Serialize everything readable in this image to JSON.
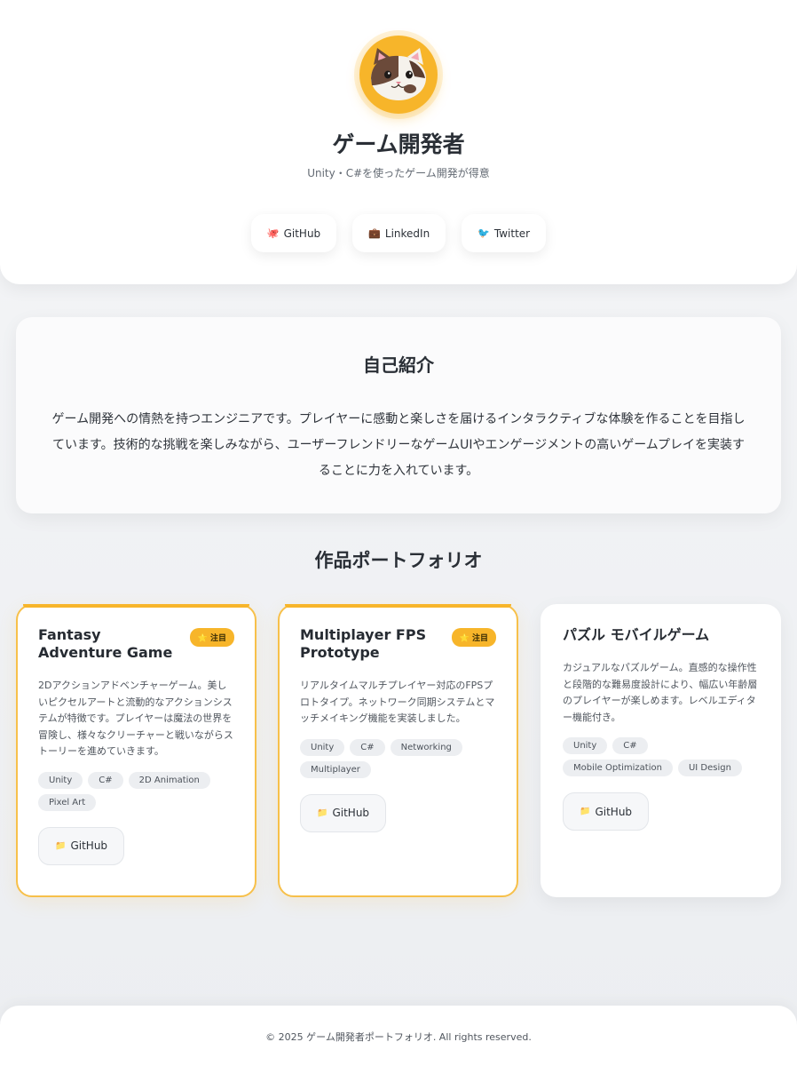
{
  "header": {
    "title": "ゲーム開発者",
    "subtitle": "Unity・C#を使ったゲーム開発が得意",
    "avatar_icon": "cat-face-icon",
    "social": [
      {
        "icon": "🐙",
        "label": "GitHub"
      },
      {
        "icon": "💼",
        "label": "LinkedIn"
      },
      {
        "icon": "🐦",
        "label": "Twitter"
      }
    ]
  },
  "about": {
    "heading": "自己紹介",
    "text": "ゲーム開発への情熱を持つエンジニアです。プレイヤーに感動と楽しさを届けるインタラクティブな体験を作ることを目指しています。技術的な挑戦を楽しみながら、ユーザーフレンドリーなゲームUIやエンゲージメントの高いゲームプレイを実装することに力を入れています。"
  },
  "portfolio": {
    "heading": "作品ポートフォリオ",
    "projects": [
      {
        "title": "Fantasy Adventure Game",
        "badge": "⭐ 注目",
        "description": "2Dアクションアドベンチャーゲーム。美しいピクセルアートと流動的なアクションシステムが特徴です。プレイヤーは魔法の世界を冒険し、様々なクリーチャーと戦いながらストーリーを進めていきます。",
        "tags": [
          "Unity",
          "C#",
          "2D Animation",
          "Pixel Art"
        ],
        "button_icon": "📁",
        "button_label": "GitHub"
      },
      {
        "title": "Multiplayer FPS Prototype",
        "badge": "⭐ 注目",
        "description": "リアルタイムマルチプレイヤー対応のFPSプロトタイプ。ネットワーク同期システムとマッチメイキング機能を実装しました。",
        "tags": [
          "Unity",
          "C#",
          "Networking",
          "Multiplayer"
        ],
        "button_icon": "📁",
        "button_label": "GitHub"
      },
      {
        "title": "パズル モバイルゲーム",
        "badge": "",
        "description": "カジュアルなパズルゲーム。直感的な操作性と段階的な難易度設計により、幅広い年齢層のプレイヤーが楽しめます。レベルエディター機能付き。",
        "tags": [
          "Unity",
          "C#",
          "Mobile Optimization",
          "UI Design"
        ],
        "button_icon": "📁",
        "button_label": "GitHub"
      }
    ]
  },
  "footer": {
    "text": "© 2025 ゲーム開発者ポートフォリオ. All rights reserved."
  },
  "colors": {
    "accent": "#f7b52a",
    "background": "#f0f1f4",
    "card": "#ffffff"
  }
}
